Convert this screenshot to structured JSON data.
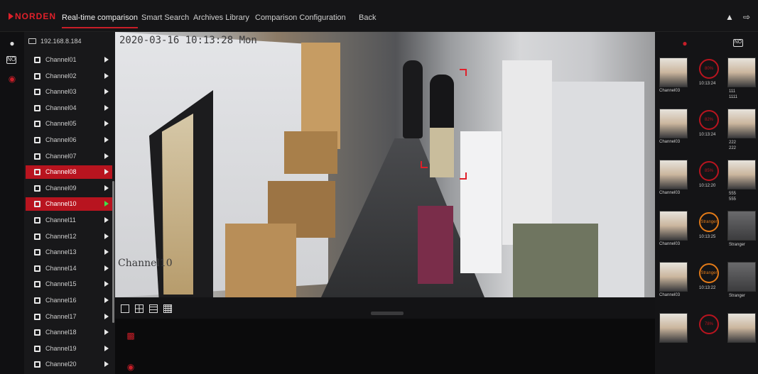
{
  "header": {
    "brand": "NORDEN",
    "nav": [
      "Real-time comparison",
      "Smart Search",
      "Archives Library",
      "Comparison Configuration",
      "Back"
    ],
    "active_nav": "Real-time comparison",
    "icons": [
      "bell-icon",
      "logout-icon"
    ]
  },
  "rail": {
    "icons": [
      "user-icon",
      "nvr-icon",
      "face-capture-icon"
    ]
  },
  "device": {
    "ip": "192.168.8.184"
  },
  "channels": [
    {
      "name": "Channel01",
      "selected": false
    },
    {
      "name": "Channel02",
      "selected": false
    },
    {
      "name": "Channel03",
      "selected": false
    },
    {
      "name": "Channel04",
      "selected": false
    },
    {
      "name": "Channel05",
      "selected": false
    },
    {
      "name": "Channel06",
      "selected": false
    },
    {
      "name": "Channel07",
      "selected": false
    },
    {
      "name": "Channel08",
      "selected": true
    },
    {
      "name": "Channel09",
      "selected": false
    },
    {
      "name": "Channel10",
      "selected": true,
      "playing": true
    },
    {
      "name": "Channel11",
      "selected": false
    },
    {
      "name": "Channel12",
      "selected": false
    },
    {
      "name": "Channel13",
      "selected": false
    },
    {
      "name": "Channel14",
      "selected": false
    },
    {
      "name": "Channel15",
      "selected": false
    },
    {
      "name": "Channel16",
      "selected": false
    },
    {
      "name": "Channel17",
      "selected": false
    },
    {
      "name": "Channel18",
      "selected": false
    },
    {
      "name": "Channel19",
      "selected": false
    },
    {
      "name": "Channel20",
      "selected": false
    }
  ],
  "video": {
    "timestamp": "2020-03-16 10:13:28 Mon",
    "channel_label": "Channel10"
  },
  "layout_buttons": [
    "layout-1x1",
    "layout-2x2",
    "layout-3x3",
    "layout-4x4"
  ],
  "right_panel": {
    "header_icons": [
      "face-match-icon",
      "nvr-icon"
    ],
    "cards": [
      {
        "channel": "Channel03",
        "time": "10:13:24",
        "score": "80%",
        "result": "111\n1111",
        "stranger": false
      },
      {
        "channel": "Channel03",
        "time": "10:13:24",
        "score": "82%",
        "result": "222\n222",
        "stranger": false
      },
      {
        "channel": "Channel03",
        "time": "10:12:20",
        "score": "85%",
        "result": "555\n555",
        "stranger": false
      },
      {
        "channel": "Channel03",
        "time": "10:13:25",
        "score": "Stranger",
        "result": "Stranger",
        "stranger": true
      },
      {
        "channel": "Channel03",
        "time": "10:13:22",
        "score": "Stranger",
        "result": "Stranger",
        "stranger": true
      },
      {
        "channel": "",
        "time": "",
        "score": "78%",
        "result": "",
        "stranger": false
      }
    ]
  },
  "colors": {
    "accent": "#c81e28",
    "orange": "#e27a18",
    "play_active": "#3ee04a"
  }
}
